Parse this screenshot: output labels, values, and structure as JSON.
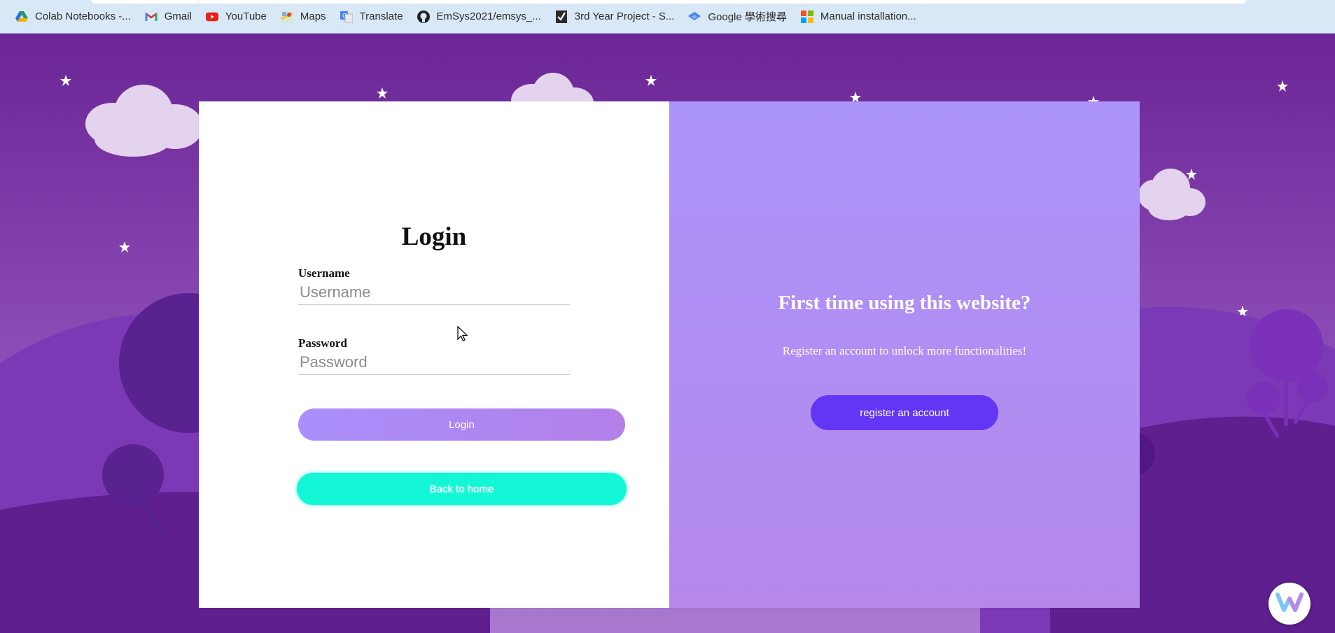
{
  "bookmarks": [
    {
      "label": "Colab Notebooks -...",
      "icon": "google-drive-icon"
    },
    {
      "label": "Gmail",
      "icon": "gmail-icon"
    },
    {
      "label": "YouTube",
      "icon": "youtube-icon"
    },
    {
      "label": "Maps",
      "icon": "maps-icon"
    },
    {
      "label": "Translate",
      "icon": "translate-icon"
    },
    {
      "label": "EmSys2021/emsys_...",
      "icon": "github-icon"
    },
    {
      "label": "3rd Year Project - S...",
      "icon": "checkmark-icon"
    },
    {
      "label": "Google 學術搜尋",
      "icon": "google-scholar-icon"
    },
    {
      "label": "Manual installation...",
      "icon": "microsoft-icon"
    }
  ],
  "login": {
    "title": "Login",
    "username_label": "Username",
    "username_placeholder": "Username",
    "password_label": "Password",
    "password_placeholder": "Password",
    "login_button": "Login",
    "home_button": "Back to home"
  },
  "register": {
    "title": "First time using this website?",
    "subtitle": "Register an account to unlock more functionalities!",
    "button": "register an account"
  },
  "colors": {
    "bookmark_bar": "#d9e8f7",
    "background_purple": "#6a2a98",
    "login_gradient_start": "#a98ffc",
    "login_gradient_end": "#b37fe8",
    "home_button": "#13f7d6",
    "register_button": "#6236f3",
    "register_panel": "#ab94fc"
  }
}
